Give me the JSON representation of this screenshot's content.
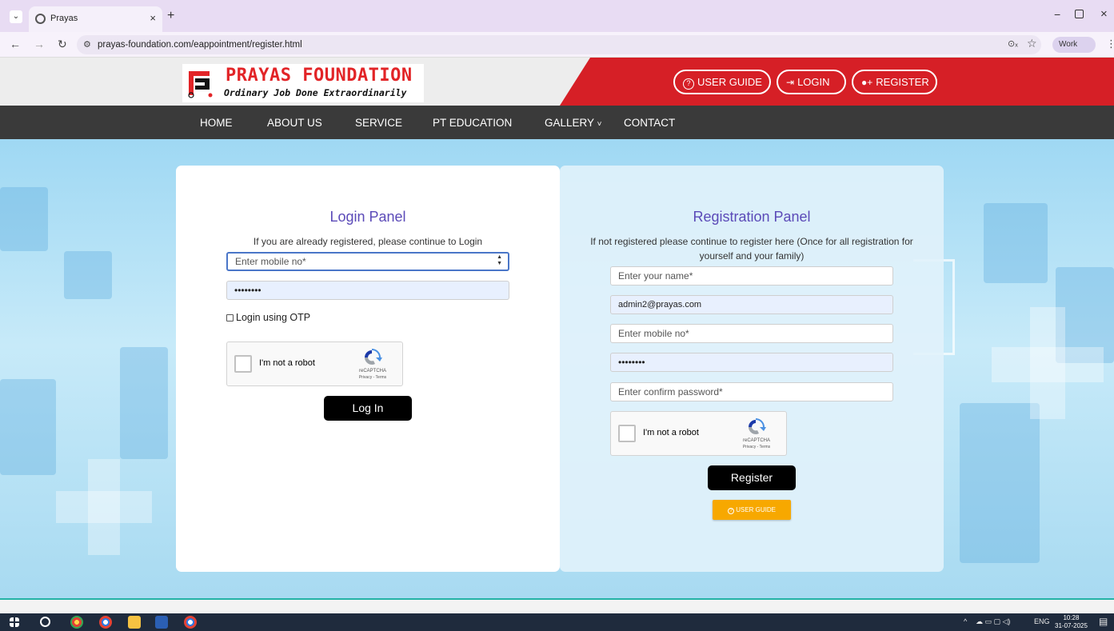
{
  "browser": {
    "tab_title": "Prayas",
    "tab_close": "×",
    "new_tab": "+",
    "url": "prayas-foundation.com/eappointment/register.html",
    "profile_label": "Work",
    "window_controls": {
      "minimize": "−",
      "close": "×"
    }
  },
  "site": {
    "brand_title": "PRAYAS FOUNDATION",
    "brand_tagline": "Ordinary Job Done Extraordinarily",
    "header_buttons": [
      {
        "label": "USER GUIDE",
        "icon": "question-circle-icon",
        "glyph": "?"
      },
      {
        "label": "LOGIN",
        "icon": "login-icon",
        "glyph": "⇥"
      },
      {
        "label": "REGISTER",
        "icon": "user-plus-icon",
        "glyph": "👤"
      }
    ],
    "nav": [
      "HOME",
      "ABOUT US",
      "SERVICE",
      "PT EDUCATION",
      "GALLERY",
      "CONTACT"
    ],
    "gallery_caret": "˅",
    "colors": {
      "brand_red": "#d61f26",
      "nav_bg": "#3a3a3a",
      "title_purple": "#5b4ab8",
      "guide_orange": "#f7a800"
    }
  },
  "login": {
    "title": "Login Panel",
    "subtitle": "If you are already registered, please continue to Login",
    "mobile_placeholder": "Enter mobile no*",
    "password_value": "••••••••",
    "otp_label": "Login using OTP",
    "captcha_label": "I'm not a robot",
    "captcha_brand": "reCAPTCHA",
    "captcha_terms": "Privacy - Terms",
    "submit_label": "Log In"
  },
  "register": {
    "title": "Registration Panel",
    "subtitle": "If not registered please continue to register here (Once for all registration for yourself and your family)",
    "name_placeholder": "Enter your name*",
    "email_value": "admin2@prayas.com",
    "mobile_placeholder": "Enter mobile no*",
    "password_value": "••••••••",
    "confirm_placeholder": "Enter confirm password*",
    "captcha_label": "I'm not a robot",
    "captcha_brand": "reCAPTCHA",
    "captcha_terms": "Privacy - Terms",
    "submit_label": "Register",
    "guide_label": "USER GUIDE",
    "guide_glyph": "?"
  },
  "taskbar": {
    "language": "ENG",
    "time": "10:28",
    "date": "31-07-2025"
  }
}
